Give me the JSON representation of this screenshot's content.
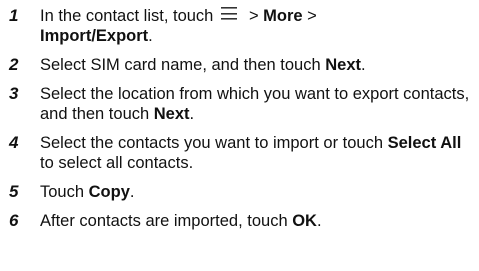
{
  "steps": [
    {
      "number": "1",
      "lead": "In the contact list, touch",
      "icon": "menu-icon",
      "sep1": " > ",
      "b1": "More",
      "sep2": " >",
      "b2": "Import/Export",
      "end": "."
    },
    {
      "number": "2",
      "lead": "Select SIM card name, and then touch ",
      "b1": "Next",
      "end": "."
    },
    {
      "number": "3",
      "lead": "Select the location from which you want to export contacts, and then touch ",
      "b1": "Next",
      "end": "."
    },
    {
      "number": "4",
      "lead": "Select the contacts you want to import or touch ",
      "b1": "Select All",
      "end": " to select all contacts."
    },
    {
      "number": "5",
      "lead": "Touch ",
      "b1": "Copy",
      "end": "."
    },
    {
      "number": "6",
      "lead": "After contacts are imported, touch ",
      "b1": "OK",
      "end": "."
    }
  ]
}
